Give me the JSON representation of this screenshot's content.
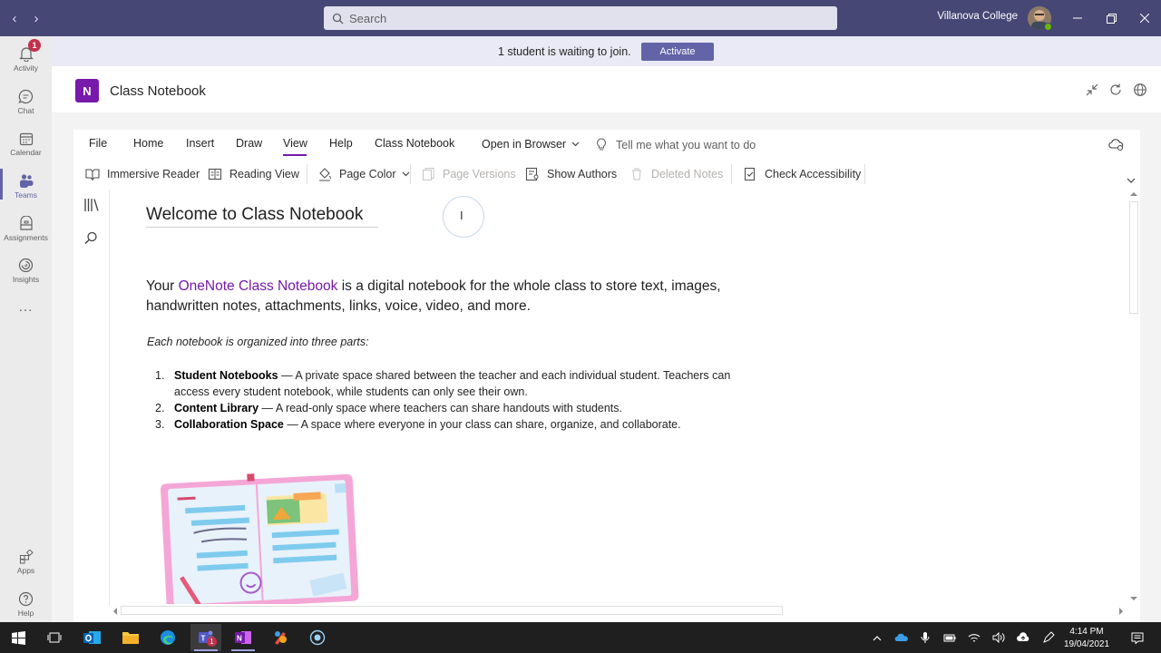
{
  "window": {
    "search_placeholder": "Search",
    "org_name": "Villanova College"
  },
  "rail": {
    "activity_badge": "1",
    "items": [
      {
        "label": "Activity",
        "icon": "bell-icon"
      },
      {
        "label": "Chat",
        "icon": "chat-icon"
      },
      {
        "label": "Calendar",
        "icon": "calendar-icon"
      },
      {
        "label": "Teams",
        "icon": "teams-icon"
      },
      {
        "label": "Assignments",
        "icon": "assignments-icon"
      },
      {
        "label": "Insights",
        "icon": "insights-icon"
      },
      {
        "label": "...",
        "icon": "more-icon"
      },
      {
        "label": "Apps",
        "icon": "apps-icon"
      },
      {
        "label": "Help",
        "icon": "help-icon"
      }
    ]
  },
  "banner": {
    "message": "1 student is waiting to join.",
    "button_label": "Activate"
  },
  "app": {
    "title": "Class Notebook",
    "logo_letter": "N"
  },
  "ribbon": {
    "tabs": [
      "File",
      "Home",
      "Insert",
      "Draw",
      "View",
      "Help",
      "Class Notebook"
    ],
    "active_tab": "View",
    "open_in_browser": "Open in Browser",
    "tell_me_placeholder": "Tell me what you want to do",
    "commands": [
      "Immersive Reader",
      "Reading View",
      "Page Color",
      "Page Versions",
      "Show Authors",
      "Deleted Notes",
      "Check Accessibility"
    ]
  },
  "page": {
    "title": "Welcome to Class Notebook",
    "intro_prefix": "Your ",
    "intro_link": "OneNote Class Notebook",
    "intro_suffix": " is a digital notebook for the whole class to store text, images, handwritten notes, attachments, links, voice, video, and more.",
    "organized_note": "Each notebook is organized into three parts:",
    "parts": [
      {
        "num": "1.",
        "name": "Student Notebooks",
        "desc": " — A private space shared between the teacher and each individual student. Teachers can access every student notebook, while students can only see their own."
      },
      {
        "num": "2.",
        "name": "Content Library",
        "desc": " — A read-only space where teachers can share handouts with students."
      },
      {
        "num": "3.",
        "name": "Collaboration Space",
        "desc": " —  A space where everyone in your class can share, organize, and collaborate."
      }
    ]
  },
  "taskbar": {
    "time": "4:14 PM",
    "date": "19/04/2021",
    "teams_badge": "1"
  },
  "colors": {
    "teams_purple": "#464775",
    "accent": "#6264a7",
    "onenote_purple": "#7719aa"
  }
}
